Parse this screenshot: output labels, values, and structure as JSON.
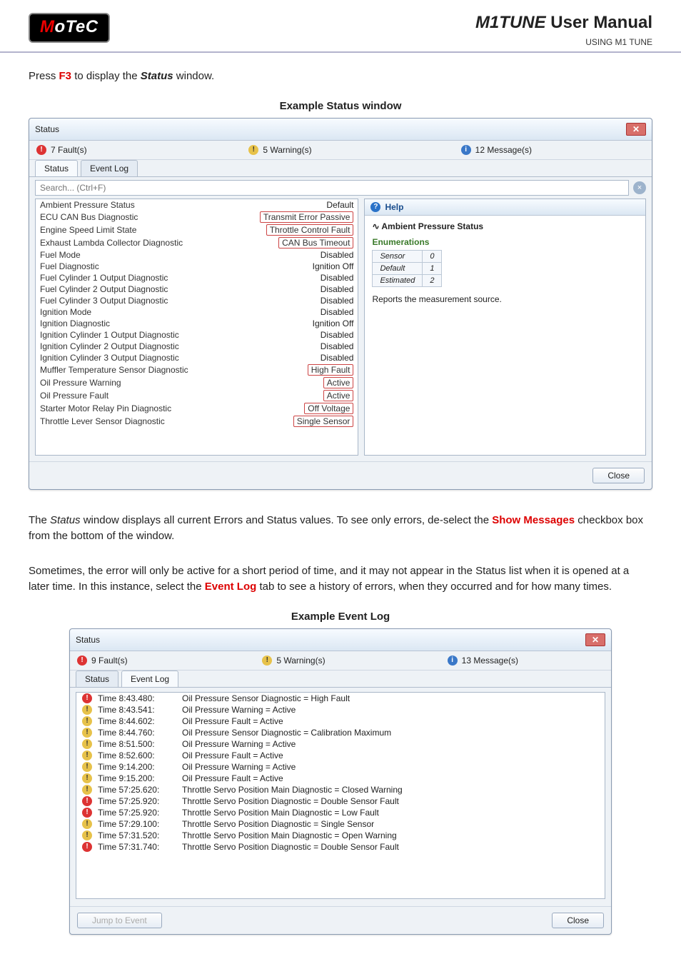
{
  "header": {
    "logo_text": "MoTeC",
    "title_prefix": "M1TUNE",
    "title_rest": " User Manual",
    "subtitle": "USING M1 TUNE"
  },
  "intro": {
    "part1": "Press ",
    "key": "F3",
    "part2": " to display the ",
    "word": "Status",
    "part3": " window."
  },
  "caption1": "Example Status window",
  "status_window": {
    "title": "Status",
    "faults": "7 Fault(s)",
    "warnings": "5 Warning(s)",
    "messages": "12 Message(s)",
    "tab_status": "Status",
    "tab_eventlog": "Event Log",
    "search_placeholder": "Search... (Ctrl+F)",
    "help_header": "Help",
    "help_title": "Ambient Pressure Status",
    "enum_header": "Enumerations",
    "enum_rows": [
      {
        "name": "Sensor",
        "val": "0"
      },
      {
        "name": "Default",
        "val": "1"
      },
      {
        "name": "Estimated",
        "val": "2"
      }
    ],
    "help_text": "Reports the measurement source.",
    "close_btn": "Close",
    "rows": [
      {
        "name": "Ambient Pressure Status",
        "value": "Default",
        "flag": false
      },
      {
        "name": "ECU CAN Bus Diagnostic",
        "value": "Transmit Error Passive",
        "flag": true
      },
      {
        "name": "Engine Speed Limit State",
        "value": "Throttle Control Fault",
        "flag": true
      },
      {
        "name": "Exhaust Lambda Collector Diagnostic",
        "value": "CAN Bus Timeout",
        "flag": true
      },
      {
        "name": "Fuel Mode",
        "value": "Disabled",
        "flag": false
      },
      {
        "name": "Fuel Diagnostic",
        "value": "Ignition Off",
        "flag": false
      },
      {
        "name": "Fuel Cylinder 1 Output Diagnostic",
        "value": "Disabled",
        "flag": false
      },
      {
        "name": "Fuel Cylinder 2 Output Diagnostic",
        "value": "Disabled",
        "flag": false
      },
      {
        "name": "Fuel Cylinder 3 Output Diagnostic",
        "value": "Disabled",
        "flag": false
      },
      {
        "name": "Ignition Mode",
        "value": "Disabled",
        "flag": false
      },
      {
        "name": "Ignition Diagnostic",
        "value": "Ignition Off",
        "flag": false
      },
      {
        "name": "Ignition Cylinder 1 Output Diagnostic",
        "value": "Disabled",
        "flag": false
      },
      {
        "name": "Ignition Cylinder 2 Output Diagnostic",
        "value": "Disabled",
        "flag": false
      },
      {
        "name": "Ignition Cylinder 3 Output Diagnostic",
        "value": "Disabled",
        "flag": false
      },
      {
        "name": "Muffler Temperature Sensor Diagnostic",
        "value": "High Fault",
        "flag": true
      },
      {
        "name": "Oil Pressure Warning",
        "value": "Active",
        "flag": true
      },
      {
        "name": "Oil Pressure Fault",
        "value": "Active",
        "flag": true
      },
      {
        "name": "Starter Motor Relay Pin Diagnostic",
        "value": "Off Voltage",
        "flag": true
      },
      {
        "name": "Throttle Lever Sensor Diagnostic",
        "value": "Single Sensor",
        "flag": true
      }
    ]
  },
  "para2a": "The ",
  "para2_status": "Status",
  "para2b": " window displays all current Errors and Status values. To see only errors, de-select the ",
  "para2_show": "Show Messages",
  "para2c": " checkbox box from the bottom of the window.",
  "para3a": "Sometimes, the error will only be active for a short period of time, and it may not appear in the Status list when it is opened at a later time. In this instance, select the ",
  "para3_ev": "Event Log",
  "para3b": " tab to see a history of errors, when they occurred and for how many times.",
  "caption2": "Example Event Log",
  "event_window": {
    "title": "Status",
    "faults": "9 Fault(s)",
    "warnings": "5 Warning(s)",
    "messages": "13 Message(s)",
    "tab_status": "Status",
    "tab_eventlog": "Event Log",
    "jump_btn": "Jump to Event",
    "close_btn": "Close",
    "rows": [
      {
        "sev": "err",
        "time": "Time 8:43.480:",
        "msg": "Oil Pressure Sensor Diagnostic = High Fault"
      },
      {
        "sev": "warn",
        "time": "Time 8:43.541:",
        "msg": "Oil Pressure Warning = Active"
      },
      {
        "sev": "warn",
        "time": "Time 8:44.602:",
        "msg": "Oil Pressure Fault = Active"
      },
      {
        "sev": "warn",
        "time": "Time 8:44.760:",
        "msg": "Oil Pressure Sensor Diagnostic = Calibration Maximum"
      },
      {
        "sev": "warn",
        "time": "Time 8:51.500:",
        "msg": "Oil Pressure Warning = Active"
      },
      {
        "sev": "warn",
        "time": "Time 8:52.600:",
        "msg": "Oil Pressure Fault = Active"
      },
      {
        "sev": "warn",
        "time": "Time 9:14.200:",
        "msg": "Oil Pressure Warning = Active"
      },
      {
        "sev": "warn",
        "time": "Time 9:15.200:",
        "msg": "Oil Pressure Fault = Active"
      },
      {
        "sev": "warn",
        "time": "Time 57:25.620:",
        "msg": "Throttle Servo Position Main Diagnostic = Closed Warning"
      },
      {
        "sev": "err",
        "time": "Time 57:25.920:",
        "msg": "Throttle Servo Position Diagnostic = Double Sensor Fault"
      },
      {
        "sev": "err",
        "time": "Time 57:25.920:",
        "msg": "Throttle Servo Position Main Diagnostic = Low Fault"
      },
      {
        "sev": "warn",
        "time": "Time 57:29.100:",
        "msg": "Throttle Servo Position Diagnostic = Single Sensor"
      },
      {
        "sev": "warn",
        "time": "Time 57:31.520:",
        "msg": "Throttle Servo Position Main Diagnostic = Open Warning"
      },
      {
        "sev": "err",
        "time": "Time 57:31.740:",
        "msg": "Throttle Servo Position Diagnostic = Double Sensor Fault"
      }
    ]
  }
}
